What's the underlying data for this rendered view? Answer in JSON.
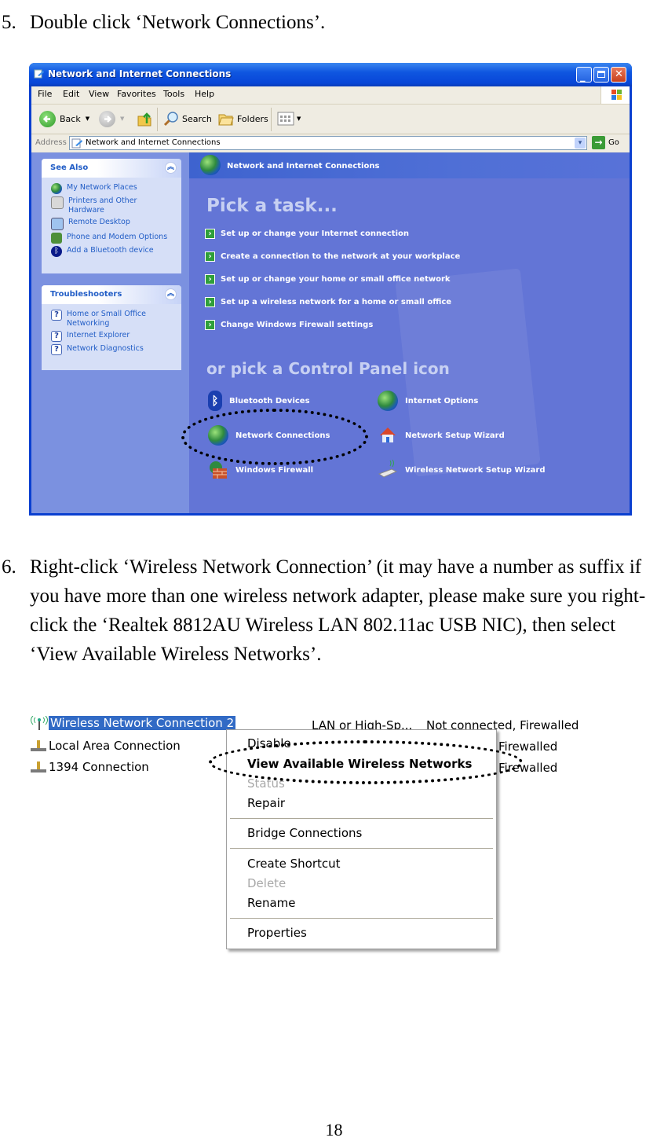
{
  "steps": {
    "step5": {
      "number": "5.",
      "text": "Double click ‘Network Connections’."
    },
    "step6": {
      "number": "6.",
      "text": "Right-click ‘Wireless Network Connection’ (it may have a number as suffix if you have more than one wireless network adapter, please make sure you right-click the ‘Realtek 8812AU Wireless LAN 802.11ac USB NIC), then select ‘View Available Wireless Networks’."
    }
  },
  "page_number": "18",
  "window": {
    "title": "Network and Internet Connections",
    "menu": [
      "File",
      "Edit",
      "View",
      "Favorites",
      "Tools",
      "Help"
    ],
    "toolbar": {
      "back": "Back",
      "search": "Search",
      "folders": "Folders"
    },
    "address": {
      "label": "Address",
      "value": "Network and Internet Connections",
      "go": "Go"
    },
    "see_also": {
      "title": "See Also",
      "items": [
        "My Network Places",
        "Printers and Other Hardware",
        "Remote Desktop",
        "Phone and Modem Options",
        "Add a Bluetooth device"
      ]
    },
    "troubleshooters": {
      "title": "Troubleshooters",
      "items": [
        "Home or Small Office Networking",
        "Internet Explorer",
        "Network Diagnostics"
      ]
    },
    "header": "Network and Internet Connections",
    "pick_task": "Pick a task...",
    "tasks": [
      "Set up or change your Internet connection",
      "Create a connection to the network at your workplace",
      "Set up or change your home or small office network",
      "Set up a wireless network for a home or small office",
      "Change Windows Firewall settings"
    ],
    "pick_icon": "or pick a Control Panel icon",
    "icons": [
      "Bluetooth Devices",
      "Internet Options",
      "Network Connections",
      "Network Setup Wizard",
      "Windows Firewall",
      "Wireless Network Setup Wizard"
    ]
  },
  "connections": {
    "rows": [
      {
        "name": "Wireless Network Connection 2",
        "type": "LAN or High-Sp...",
        "status": "Not connected, Firewalled"
      },
      {
        "name": "Local Area Connection",
        "status": "Firewalled"
      },
      {
        "name": "1394 Connection",
        "status": "Firewalled"
      }
    ],
    "context_menu": [
      {
        "label": "Disable"
      },
      {
        "label": "View Available Wireless Networks"
      },
      {
        "label": "Status"
      },
      {
        "label": "Repair"
      },
      {
        "label": "Bridge Connections"
      },
      {
        "label": "Create Shortcut"
      },
      {
        "label": "Delete"
      },
      {
        "label": "Rename"
      },
      {
        "label": "Properties"
      }
    ]
  }
}
